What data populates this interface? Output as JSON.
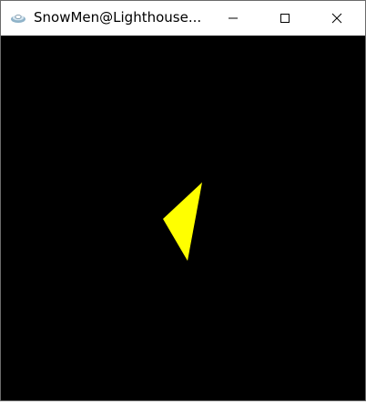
{
  "window": {
    "title": "SnowMen@Lighthouse..."
  },
  "controls": {
    "minimize_icon": "minimize-icon",
    "maximize_icon": "maximize-icon",
    "close_icon": "close-icon"
  },
  "scene": {
    "background": "#000000",
    "shape_color": "#ffff00"
  }
}
